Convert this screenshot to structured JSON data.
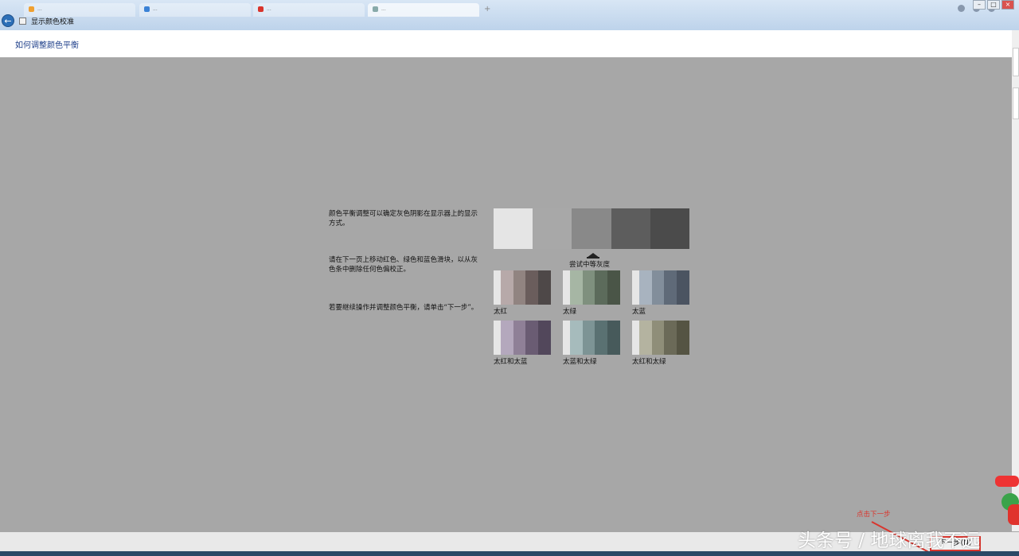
{
  "browser": {
    "tabs": [
      {
        "label": "...",
        "favicon_color": "#f0a030"
      },
      {
        "label": "...",
        "favicon_color": "#3b82d6"
      },
      {
        "label": "...",
        "favicon_color": "#d9342b"
      },
      {
        "label": "...",
        "favicon_color": "#8aa"
      }
    ]
  },
  "dialog": {
    "title": "显示颜色校准",
    "heading": "如何调整颜色平衡"
  },
  "instructions": {
    "p1": "颜色平衡调整可以确定灰色阴影在显示器上的显示方式。",
    "p2": "请在下一页上移动红色、绿色和蓝色滑块，以从灰色条中删除任何色偏校正。",
    "p3": "若要继续操作并调整颜色平衡，请单击“下一步”。"
  },
  "gray_strip": {
    "colors": [
      "#e5e5e5",
      "#a8a8a8",
      "#898989",
      "#5d5d5d",
      "#4b4b4b"
    ],
    "label": "尝试中等灰度"
  },
  "swatches": [
    {
      "label": "太红",
      "colors": [
        "#e6e6e6",
        "#b7a9a9",
        "#918481",
        "#6a5d5c",
        "#4e4848"
      ]
    },
    {
      "label": "太绿",
      "colors": [
        "#e6e6e6",
        "#a6b6a4",
        "#7f907e",
        "#5c6b5b",
        "#4a5547"
      ]
    },
    {
      "label": "太蓝",
      "colors": [
        "#e6e6e6",
        "#a8b3bf",
        "#828e9b",
        "#5f6a78",
        "#4b5461"
      ]
    },
    {
      "label": "太红和太蓝",
      "colors": [
        "#e6e6e6",
        "#b4a8bd",
        "#8f8097",
        "#6a5c73",
        "#52475b"
      ]
    },
    {
      "label": "太蓝和太绿",
      "colors": [
        "#e6e6e6",
        "#a6bbbc",
        "#7d9495",
        "#5a7172",
        "#475a5b"
      ]
    },
    {
      "label": "太红和太绿",
      "colors": [
        "#e6e6e6",
        "#b4b3a0",
        "#8f8e79",
        "#6b6a58",
        "#555443"
      ]
    }
  ],
  "footer": {
    "next_label": "下一步(N)",
    "annotation": "点击下一步",
    "watermark": "头条号 / 地球离我不远"
  },
  "colors": {
    "background": "#a7a7a7",
    "heading": "#1e3f8a",
    "annotation": "#d9362e"
  }
}
